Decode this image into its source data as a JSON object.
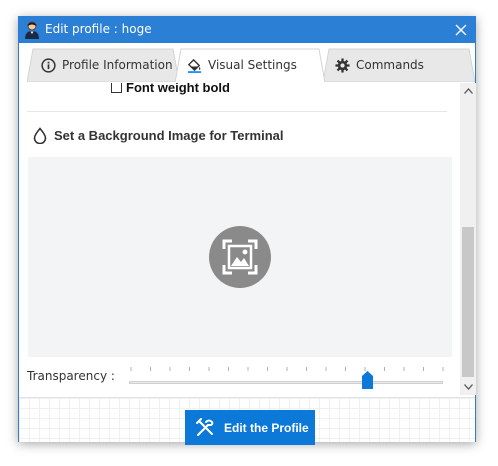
{
  "window": {
    "title": "Edit profile : hoge",
    "accent_color": "#2b7fd4"
  },
  "tabs": [
    {
      "label": "Profile Information",
      "icon": "info-circle-icon",
      "active": false
    },
    {
      "label": "Visual Settings",
      "icon": "paint-bucket-icon",
      "active": true
    },
    {
      "label": "Commands",
      "icon": "gear-icon",
      "active": false
    }
  ],
  "visual_settings": {
    "font_weight_bold": {
      "label": "Font weight bold",
      "checked": false
    },
    "background_section": {
      "title": "Set a Background Image for Terminal",
      "icon": "drop-icon",
      "placeholder_icon": "image-placeholder-icon"
    },
    "transparency": {
      "label": "Transparency :",
      "value_fraction": 0.76
    }
  },
  "footer": {
    "edit_button_label": "Edit the Profile",
    "edit_button_icon": "tools-icon",
    "button_color": "#0c79d8"
  }
}
